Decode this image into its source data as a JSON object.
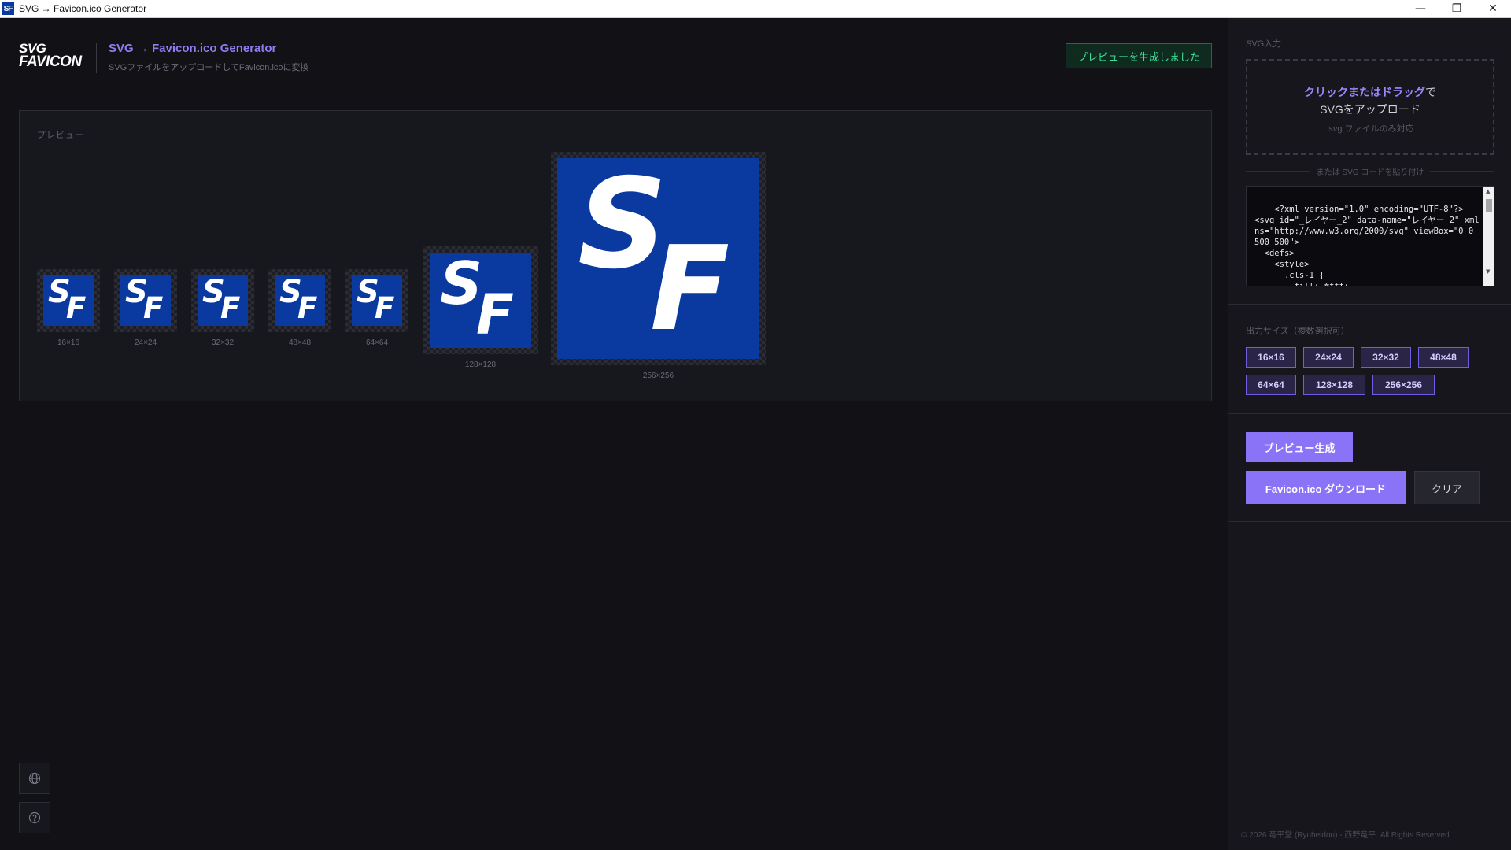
{
  "window": {
    "title": "SVG → Favicon.ico Generator",
    "icon_text": "SF",
    "minimize": "—",
    "restore": "❐",
    "close": "✕"
  },
  "header": {
    "logo_line1": "SVG",
    "logo_line2": "FAVICON",
    "title": "SVG → Favicon.ico Generator",
    "subtitle": "SVGファイルをアップロードしてFavicon.icoに変換",
    "status": "プレビューを生成しました"
  },
  "preview": {
    "label": "プレビュー",
    "items": [
      {
        "caption": "16×16"
      },
      {
        "caption": "24×24"
      },
      {
        "caption": "32×32"
      },
      {
        "caption": "48×48"
      },
      {
        "caption": "64×64"
      },
      {
        "caption": "128×128"
      },
      {
        "caption": "256×256"
      }
    ],
    "tile_text_s": "S",
    "tile_text_f": "F"
  },
  "sidebar_buttons": {
    "language_icon": "globe-icon",
    "help_icon": "help-icon"
  },
  "sidebar": {
    "svg_input_label": "SVG入力",
    "dropzone": {
      "accent": "クリックまたはドラッグ",
      "suffix": "で",
      "line2": "SVGをアップロード",
      "line3": ".svg ファイルのみ対応"
    },
    "paste_label": "または SVG コードを貼り付け",
    "code": "<?xml version=\"1.0\" encoding=\"UTF-8\"?>\n<svg id=\"_レイヤー_2\" data-name=\"レイヤー 2\" xmlns=\"http://www.w3.org/2000/svg\" viewBox=\"0 0 500 500\">\n  <defs>\n    <style>\n      .cls-1 {\n        fill: #fff;\n      }",
    "output_size_label": "出力サイズ（複数選択可）",
    "sizes": [
      "16×16",
      "24×24",
      "32×32",
      "48×48",
      "64×64",
      "128×128",
      "256×256"
    ],
    "preview_button": "プレビュー生成",
    "download_button": "Favicon.ico ダウンロード",
    "clear_button": "クリア",
    "footer": "© 2026 竜平堂 (Ryuheidou) - 西野竜平. All Rights Reserved."
  },
  "colors": {
    "accent": "#8a73f7",
    "tile_blue": "#0a3aa0",
    "status_green": "#3ddc97"
  }
}
